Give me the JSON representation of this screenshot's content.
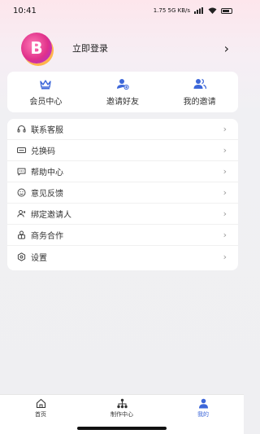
{
  "status_bar": {
    "time": "10:41",
    "network_info": "1.75 5G KB/s"
  },
  "profile": {
    "logo_letter": "B",
    "login_label": "立即登录"
  },
  "quick_actions": [
    {
      "label": "会员中心",
      "icon": "crown-icon"
    },
    {
      "label": "邀请好友",
      "icon": "add-user-icon"
    },
    {
      "label": "我的邀请",
      "icon": "users-icon"
    }
  ],
  "menu": [
    {
      "label": "联系客服",
      "icon": "headset-icon"
    },
    {
      "label": "兑换码",
      "icon": "ticket-icon"
    },
    {
      "label": "帮助中心",
      "icon": "help-chat-icon"
    },
    {
      "label": "意见反馈",
      "icon": "feedback-icon"
    },
    {
      "label": "绑定邀请人",
      "icon": "bind-user-icon"
    },
    {
      "label": "商务合作",
      "icon": "business-icon"
    },
    {
      "label": "设置",
      "icon": "settings-icon"
    }
  ],
  "tabbar": [
    {
      "label": "首页",
      "icon": "home-icon"
    },
    {
      "label": "制作中心",
      "icon": "sitemap-icon"
    },
    {
      "label": "我的",
      "icon": "person-icon",
      "active": true
    }
  ],
  "colors": {
    "accent": "#3d67d9"
  }
}
